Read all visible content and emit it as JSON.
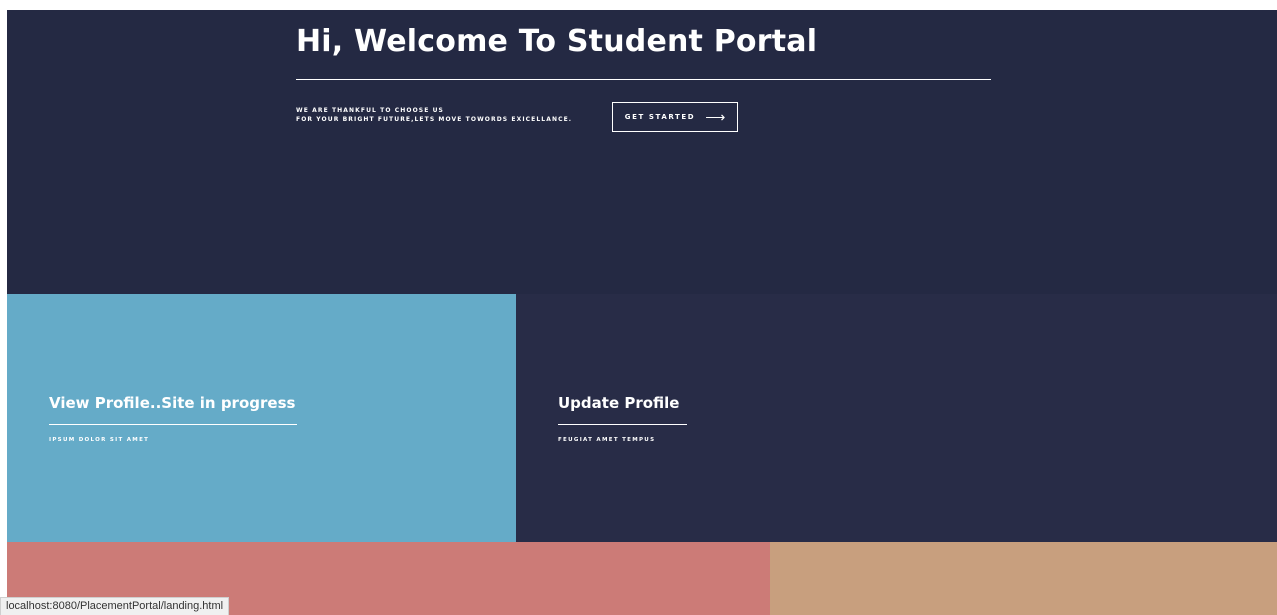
{
  "hero": {
    "title": "Hi, Welcome To Student Portal",
    "tagline_line1": "WE ARE THANKFUL TO CHOOSE US",
    "tagline_line2": "FOR YOUR BRIGHT FUTURE,LETS MOVE TOWORDS EXICELLANCE.",
    "cta_label": "GET STARTED",
    "cta_icon": "arrow-right-icon",
    "background": "#242943"
  },
  "tiles": [
    {
      "heading": "View Profile..Site in progress",
      "subtext": "IPSUM DOLOR SIT AMET",
      "color": "#65abc8"
    },
    {
      "heading": "Update Profile",
      "subtext": "FEUGIAT AMET TEMPUS",
      "color": "#282c47"
    },
    {
      "heading": "",
      "subtext": "",
      "color": "#cc7b77"
    },
    {
      "heading": "",
      "subtext": "",
      "color": "#c89f7e"
    }
  ],
  "status_bar": {
    "url": "localhost:8080/PlacementPortal/landing.html"
  }
}
